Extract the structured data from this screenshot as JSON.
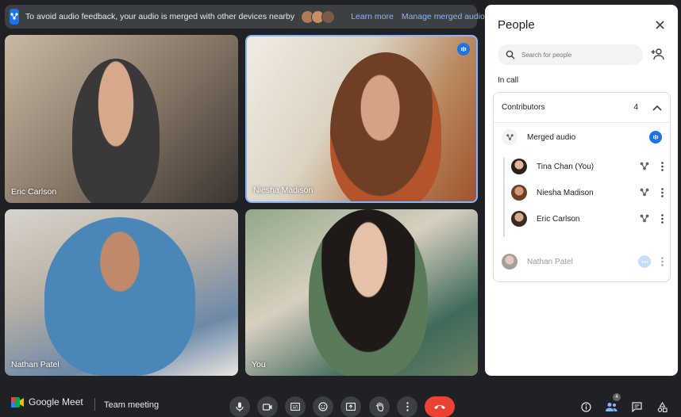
{
  "banner": {
    "message": "To avoid audio feedback, your audio is merged with other devices nearby",
    "learn_more": "Learn more",
    "manage": "Manage merged audio"
  },
  "tiles": [
    {
      "name": "Eric Carlson"
    },
    {
      "name": "Niesha Madison"
    },
    {
      "name": "Nathan Patel"
    },
    {
      "name": "You"
    }
  ],
  "panel": {
    "title": "People",
    "search_placeholder": "Search for people",
    "in_call": "In call",
    "contributors_label": "Contributors",
    "contributors_count": "4",
    "merged_audio": "Merged audio",
    "members": [
      {
        "name": "Tina Chan (You)"
      },
      {
        "name": "Niesha Madison"
      },
      {
        "name": "Eric Carlson"
      }
    ],
    "other": {
      "name": "Nathan Patel"
    }
  },
  "bottom": {
    "app_name": "Google Meet",
    "meeting_name": "Team meeting",
    "people_count": "4"
  },
  "colors": {
    "accent": "#1a73e8",
    "link": "#8ab4f8",
    "hangup": "#ea4335",
    "surface": "#3c4043",
    "background": "#202124"
  }
}
